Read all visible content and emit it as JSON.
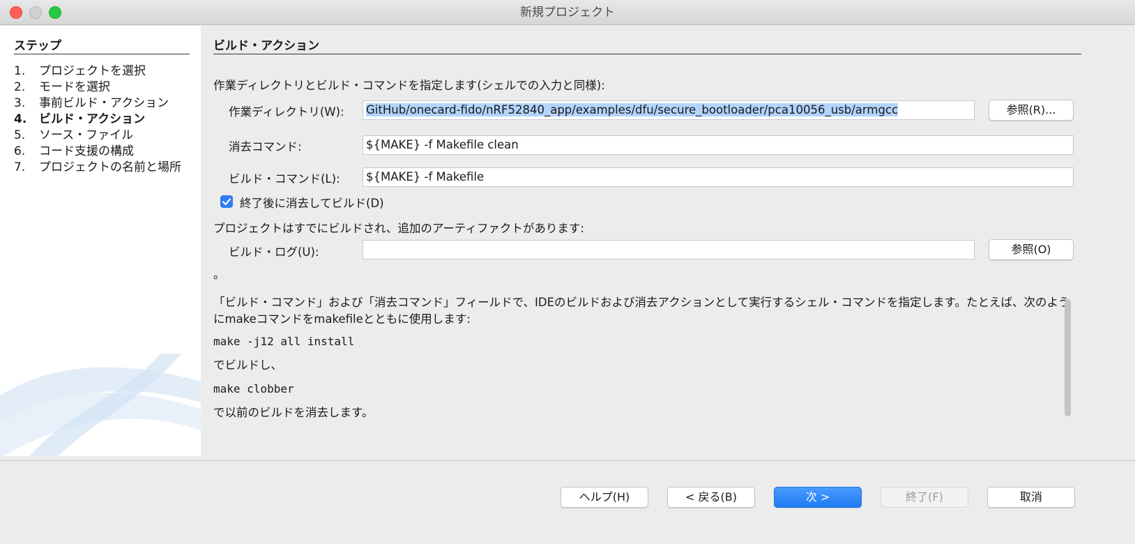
{
  "window": {
    "title": "新規プロジェクト"
  },
  "steps": {
    "heading": "ステップ",
    "items": [
      {
        "num": "1.",
        "label": "プロジェクトを選択"
      },
      {
        "num": "2.",
        "label": "モードを選択"
      },
      {
        "num": "3.",
        "label": "事前ビルド・アクション"
      },
      {
        "num": "4.",
        "label": "ビルド・アクション"
      },
      {
        "num": "5.",
        "label": "ソース・ファイル"
      },
      {
        "num": "6.",
        "label": "コード支援の構成"
      },
      {
        "num": "7.",
        "label": "プロジェクトの名前と場所"
      }
    ],
    "active_index": 3
  },
  "main": {
    "title": "ビルド・アクション",
    "description": "作業ディレクトリとビルド・コマンドを指定します(シェルでの入力と同様):",
    "working_dir": {
      "label": "作業ディレクトリ(W):",
      "value": "GitHub/onecard-fido/nRF52840_app/examples/dfu/secure_bootloader/pca10056_usb/armgcc",
      "browse_label": "参照(R)..."
    },
    "clean_command": {
      "label": "消去コマンド:",
      "value": "${MAKE} -f Makefile clean"
    },
    "build_command": {
      "label": "ビルド・コマンド(L):",
      "value": "${MAKE} -f Makefile"
    },
    "clean_and_build": {
      "label": "終了後に消去してビルド(D)",
      "checked": true
    },
    "artifacts_text": "プロジェクトはすでにビルドされ、追加のアーティファクトがあります:",
    "build_log": {
      "label": "ビルド・ログ(U):",
      "value": "",
      "browse_label": "参照(O)"
    }
  },
  "help": {
    "fragment": "。",
    "para1": "「ビルド・コマンド」および「消去コマンド」フィールドで、IDEのビルドおよび消去アクションとして実行するシェル・コマンドを指定します。たとえば、次のようにmakeコマンドをmakefileとともに使用します:",
    "code1": "make -j12 all install",
    "text2": "でビルドし、",
    "code2": "make clobber",
    "text3": "で以前のビルドを消去します。"
  },
  "buttons": {
    "help": "ヘルプ(H)",
    "back": "< 戻る(B)",
    "next": "次 >",
    "finish": "終了(F)",
    "cancel": "取消"
  },
  "colors": {
    "accent": "#1f7bf5",
    "selection": "#b3d4fc",
    "close": "#fe5f57",
    "maximize": "#28c840"
  }
}
